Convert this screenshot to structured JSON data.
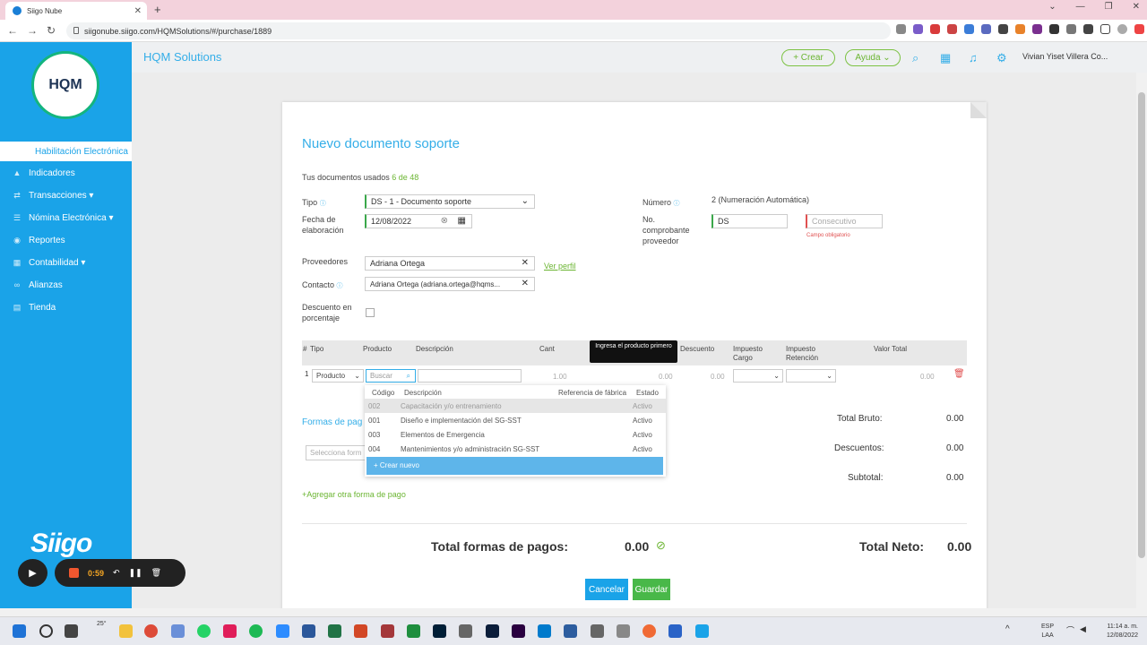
{
  "browser": {
    "tab_title": "Siigo Nube",
    "url": "siigonube.siigo.com/HQMSolutions/#/purchase/1889"
  },
  "sidebar": {
    "logo_text": "HQM",
    "items": [
      {
        "label": "Habilitación Electrónica"
      },
      {
        "label": "Indicadores"
      },
      {
        "label": "Transacciones ▾"
      },
      {
        "label": "Nómina Electrónica ▾"
      },
      {
        "label": "Reportes"
      },
      {
        "label": "Contabilidad ▾"
      },
      {
        "label": "Alianzas"
      },
      {
        "label": "Tienda"
      }
    ],
    "brand": "Siigo"
  },
  "recorder": {
    "time": "0:59"
  },
  "topbar": {
    "company": "HQM Solutions",
    "create_label": "+ Crear",
    "help_label": "Ayuda ⌄",
    "user": "Vivian Yiset Villera Co..."
  },
  "form": {
    "title": "Nuevo documento soporte",
    "usage_label": "Tus documentos usados",
    "usage_value": "6 de 48",
    "tipo_label": "Tipo",
    "tipo_value": "DS - 1 - Documento soporte",
    "fecha_label": "Fecha de elaboración",
    "fecha_value": "12/08/2022",
    "numero_label": "Número",
    "numero_value": "2 (Numeración Automática)",
    "no_comprobante_label": "No. comprobante proveedor",
    "prefijo_value": "DS",
    "consecutivo_placeholder": "Consecutivo",
    "campo_obligatorio": "Campo obligatorio",
    "proveedores_label": "Proveedores",
    "proveedores_value": "Adriana Ortega",
    "ver_perfil": "Ver perfil",
    "contacto_label": "Contacto",
    "contacto_value": "Adriana Ortega (adriana.ortega@hqms...",
    "descuento_label": "Descuento en porcentaje"
  },
  "grid": {
    "headers": [
      "#",
      "Tipo",
      "Producto",
      "Descripción",
      "Cant",
      "Descuento",
      "Impuesto Cargo",
      "Impuesto Retención",
      "Valor Total"
    ],
    "tooltip": "Ingresa el producto primero",
    "row": {
      "num": "1",
      "tipo": "Producto",
      "buscar_placeholder": "Buscar",
      "cant": "1.00",
      "valor": "0.00",
      "descuento": "0.00",
      "total": "0.00"
    }
  },
  "dropdown": {
    "headers": [
      "Código",
      "Descripción",
      "Referencia de fábrica",
      "Estado"
    ],
    "rows": [
      {
        "codigo": "002",
        "descripcion": "Capacitación y/o entrenamiento",
        "estado": "Activo"
      },
      {
        "codigo": "001",
        "descripcion": "Diseño e implementación del SG-SST",
        "estado": "Activo"
      },
      {
        "codigo": "003",
        "descripcion": "Elementos de Emergencia",
        "estado": "Activo"
      },
      {
        "codigo": "004",
        "descripcion": "Mantenimientos y/o administración SG-SST",
        "estado": "Activo"
      }
    ],
    "create_label": "+ Crear nuevo"
  },
  "payments": {
    "title": "Formas de pag",
    "select_placeholder": "Selecciona form",
    "add_label": "+Agregar otra forma de pago",
    "total_label": "Total formas de pagos:",
    "total_value": "0.00"
  },
  "totals": {
    "bruto_label": "Total Bruto:",
    "bruto": "0.00",
    "descuentos_label": "Descuentos:",
    "descuentos": "0.00",
    "subtotal_label": "Subtotal:",
    "subtotal": "0.00",
    "neto_label": "Total Neto:",
    "neto": "0.00"
  },
  "actions": {
    "cancel": "Cancelar",
    "save": "Guardar"
  },
  "taskbar": {
    "temp": "25°",
    "lang1": "ESP",
    "lang2": "LAA",
    "time": "11:14 a. m.",
    "date": "12/08/2022"
  },
  "colors": {
    "brand_blue": "#1aa3e8",
    "accent_green": "#1fb87a",
    "link_green": "#6bb532"
  }
}
